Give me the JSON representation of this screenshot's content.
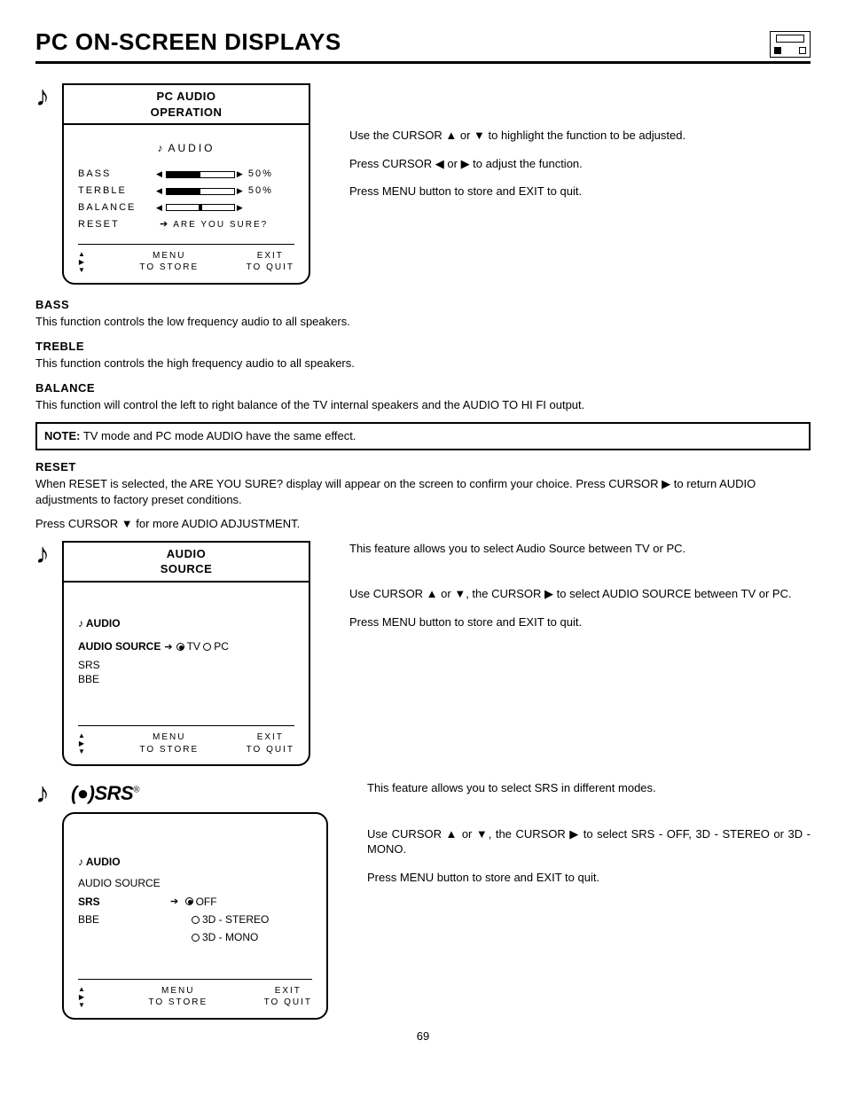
{
  "page": {
    "title": "PC ON-SCREEN DISPLAYS",
    "number": "69"
  },
  "osd1": {
    "label_l1": "PC AUDIO",
    "label_l2": "OPERATION",
    "title": "AUDIO",
    "rows": {
      "bass": "BASS",
      "terble": "TERBLE",
      "balance": "BALANCE",
      "reset": "RESET",
      "bass_val": "50%",
      "terble_val": "50%",
      "reset_prompt": "ARE YOU SURE?"
    },
    "footer": {
      "menu": "MENU",
      "store": "TO STORE",
      "exit": "EXIT",
      "quit": "TO QUIT"
    }
  },
  "instr1": {
    "p1": "Use the CURSOR ▲ or ▼ to highlight the function to be adjusted.",
    "p2": "Press CURSOR ◀ or ▶ to adjust the function.",
    "p3": "Press MENU button to store and EXIT to quit."
  },
  "desc": {
    "bass_t": "BASS",
    "bass_b": "This function controls the low frequency audio to all speakers.",
    "treble_t": "TREBLE",
    "treble_b": "This function controls the high frequency audio to all speakers.",
    "balance_t": "BALANCE",
    "balance_b": "This function will control the left to right balance of the TV internal speakers and the AUDIO TO HI FI output.",
    "note_label": "NOTE:",
    "note_body": " TV mode and PC mode AUDIO have the same effect.",
    "reset_t": "RESET",
    "reset_b": "When RESET is selected, the  ARE YOU SURE?  display will appear on the screen to confirm your choice. Press CURSOR ▶ to return AUDIO adjustments to factory preset conditions.",
    "more": "Press CURSOR ▼ for more AUDIO ADJUSTMENT."
  },
  "osd2": {
    "label_l1": "AUDIO",
    "label_l2": "SOURCE",
    "title": "AUDIO",
    "rows": {
      "src": "AUDIO SOURCE",
      "tv": "TV",
      "pc": "PC",
      "srs": "SRS",
      "bbe": "BBE"
    },
    "footer": {
      "menu": "MENU",
      "store": "TO STORE",
      "exit": "EXIT",
      "quit": "TO QUIT"
    }
  },
  "instr2": {
    "intro": "This feature allows you to select Audio Source between TV or PC.",
    "p1": "Use CURSOR ▲ or ▼, the CURSOR ▶ to select AUDIO SOURCE between TV or PC.",
    "p2": "Press MENU button to store and EXIT to quit."
  },
  "osd3": {
    "logo": "SRS",
    "title": "AUDIO",
    "rows": {
      "src": "AUDIO SOURCE",
      "srs": "SRS",
      "bbe": "BBE",
      "off": "OFF",
      "stereo": "3D - STEREO",
      "mono": "3D - MONO"
    },
    "footer": {
      "menu": "MENU",
      "store": "TO STORE",
      "exit": "EXIT",
      "quit": "TO QUIT"
    }
  },
  "instr3": {
    "intro": "This feature allows you to select SRS in different modes.",
    "p1": "Use CURSOR ▲ or ▼, the CURSOR ▶ to select SRS - OFF, 3D - STEREO or 3D - MONO.",
    "p2": "Press MENU button to store and EXIT to quit."
  }
}
